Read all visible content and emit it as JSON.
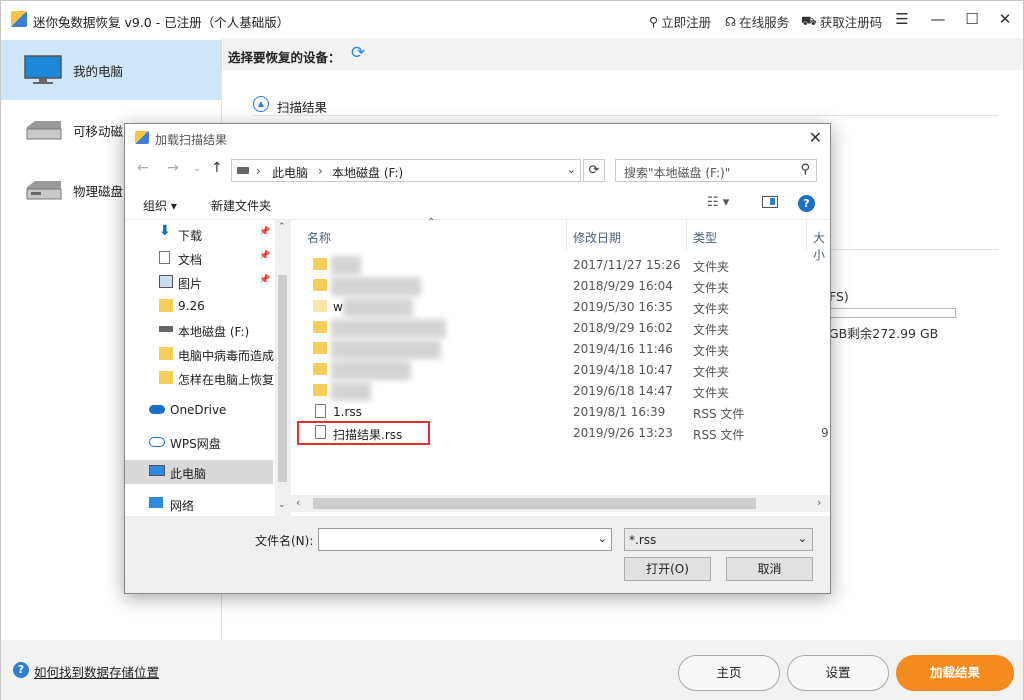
{
  "window": {
    "title": "迷你兔数据恢复 v9.0 - 已注册（个人基础版）",
    "links": [
      "立即注册",
      "在线服务",
      "获取注册码"
    ]
  },
  "sidebar": {
    "items": [
      {
        "label": "我的电脑"
      },
      {
        "label": "可移动磁盘"
      },
      {
        "label": "物理磁盘"
      }
    ]
  },
  "main": {
    "device_title": "选择要恢复的设备：",
    "scan_result": "扫描结果",
    "fs_fragment": "FS)",
    "free_fragment": "GB剩余272.99 GB"
  },
  "bottom": {
    "help": "如何找到数据存储位置",
    "home": "主页",
    "settings": "设置",
    "load": "加载结果"
  },
  "dialog": {
    "title": "加载扫描结果",
    "breadcrumb": [
      "此电脑",
      "本地磁盘 (F:)"
    ],
    "search_placeholder": "搜索\"本地磁盘 (F:)\"",
    "organize": "组织 ▾",
    "new_folder": "新建文件夹",
    "nav": [
      {
        "label": "下载"
      },
      {
        "label": "文档"
      },
      {
        "label": "图片"
      },
      {
        "label": "9.26"
      },
      {
        "label": "本地磁盘 (F:)"
      },
      {
        "label": "电脑中病毒而造成"
      },
      {
        "label": "怎样在电脑上恢复"
      },
      {
        "label": "OneDrive"
      },
      {
        "label": "WPS网盘"
      },
      {
        "label": "此电脑"
      },
      {
        "label": "网络"
      }
    ],
    "columns": [
      "名称",
      "修改日期",
      "类型",
      "大小"
    ],
    "files": [
      {
        "name": "",
        "date": "2017/11/27 15:26",
        "type": "文件夹",
        "size": ""
      },
      {
        "name": "",
        "date": "2018/9/29 16:04",
        "type": "文件夹",
        "size": ""
      },
      {
        "name": "w",
        "date": "2019/5/30 16:35",
        "type": "文件夹",
        "size": ""
      },
      {
        "name": "",
        "date": "2018/9/29 16:02",
        "type": "文件夹",
        "size": ""
      },
      {
        "name": "",
        "date": "2019/4/16 11:46",
        "type": "文件夹",
        "size": ""
      },
      {
        "name": "",
        "date": "2019/4/18 10:47",
        "type": "文件夹",
        "size": ""
      },
      {
        "name": "",
        "date": "2019/6/18 14:47",
        "type": "文件夹",
        "size": ""
      },
      {
        "name": "1.rss",
        "date": "2019/8/1 16:39",
        "type": "RSS 文件",
        "size": ""
      },
      {
        "name": "扫描结果.rss",
        "date": "2019/9/26 13:23",
        "type": "RSS 文件",
        "size": "9"
      }
    ],
    "filename_label": "文件名(N):",
    "filetype": "*.rss",
    "open": "打开(O)",
    "cancel": "取消"
  }
}
